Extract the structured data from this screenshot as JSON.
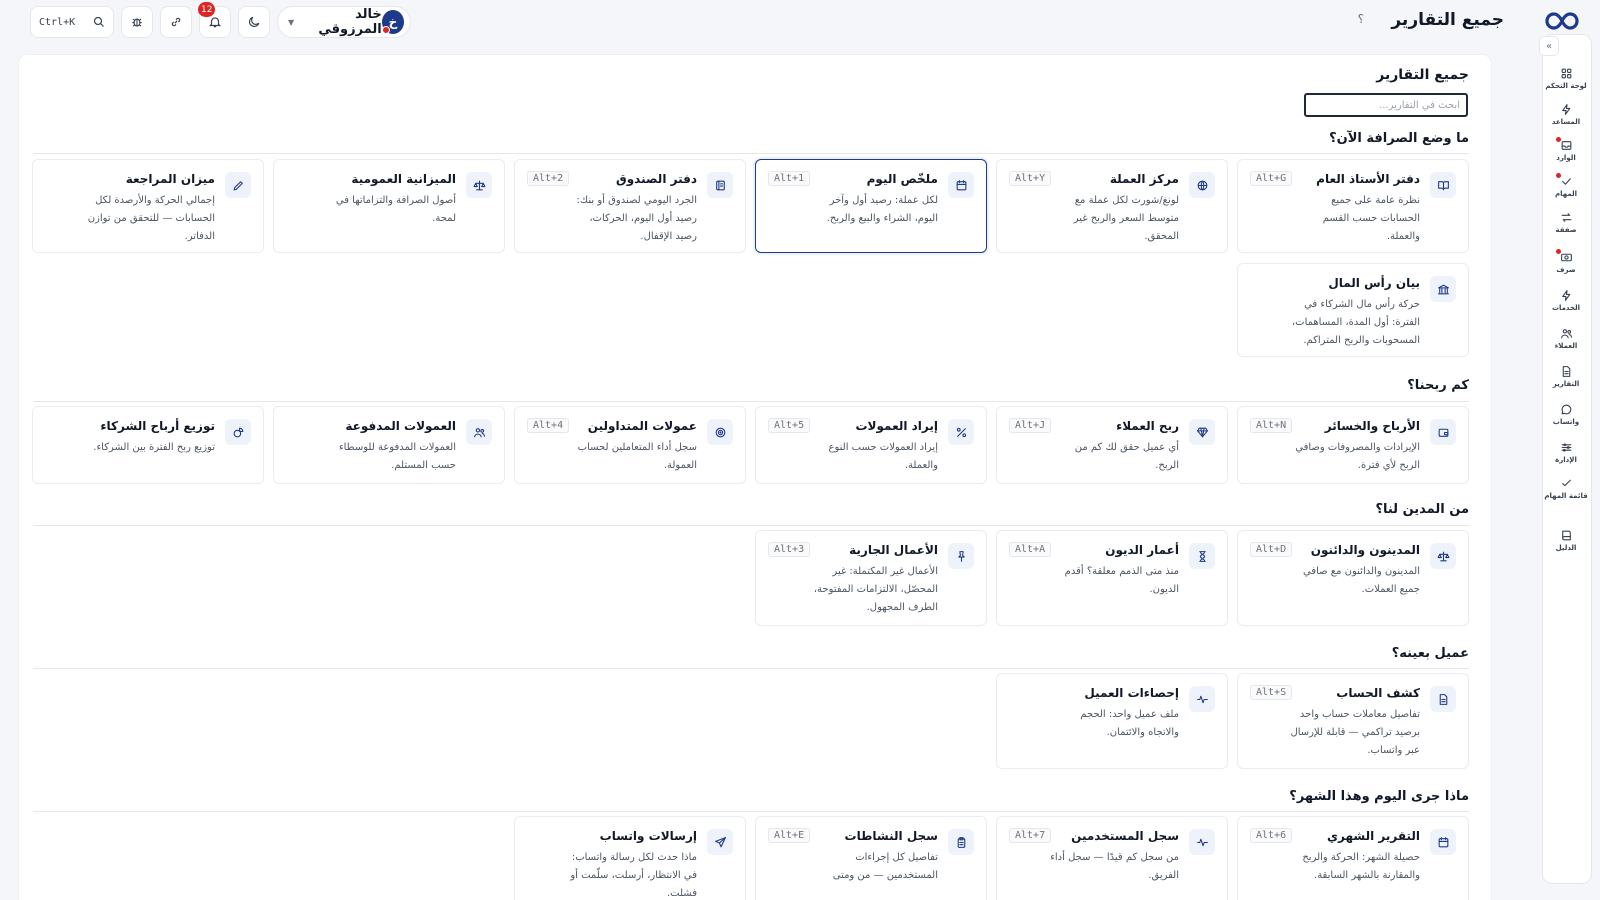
{
  "header": {
    "title": "جميع التقارير",
    "help": "؟",
    "search_shortcut": "Ctrl+K",
    "notifications_count": "12",
    "user": {
      "name": "خالد المرزوقي",
      "initial": "خ"
    }
  },
  "sidebar": {
    "items": [
      {
        "label": "لوحة التحكم",
        "icon": "dashboard-icon"
      },
      {
        "label": "المساعد",
        "icon": "bolt-icon"
      },
      {
        "label": "الوارد",
        "icon": "inbox-icon",
        "dot": true
      },
      {
        "label": "المهام",
        "icon": "check-icon",
        "dot": true
      },
      {
        "label": "صفقة",
        "icon": "exchange-icon"
      },
      {
        "label": "صرف",
        "icon": "cash-icon",
        "dot": true
      },
      {
        "label": "الخدمات",
        "icon": "bolt-icon"
      },
      {
        "label": "العملاء",
        "icon": "users-icon"
      },
      {
        "label": "التقارير",
        "icon": "document-icon"
      },
      {
        "label": "واتساب",
        "icon": "chat-icon"
      },
      {
        "label": "الإدارة",
        "icon": "sliders-icon"
      },
      {
        "label": "قائمة المهام",
        "icon": "checklist-icon"
      },
      {
        "label": "الدليل",
        "icon": "book-icon"
      }
    ]
  },
  "main": {
    "title": "جميع التقارير",
    "search_placeholder": "ابحث في التقارير...",
    "sections": [
      {
        "title": "ما وضع الصرافة الآن؟",
        "cards": [
          {
            "title": "دفتر الأستاذ العام",
            "desc": "نظرة عامة على جميع الحسابات حسب القسم والعملة.",
            "kbd": "Alt+G",
            "icon": "book-open-icon"
          },
          {
            "title": "مركز العملة",
            "desc": "لونغ/شورت لكل عملة مع متوسط السعر والربح غير المحقق.",
            "kbd": "Alt+Y",
            "icon": "globe-icon"
          },
          {
            "title": "ملخّص اليوم",
            "desc": "لكل عملة: رصيد أول وآخر اليوم، الشراء والبيع والربح.",
            "kbd": "Alt+1",
            "icon": "calendar-icon",
            "active": true
          },
          {
            "title": "دفتر الصندوق",
            "desc": "الجرد اليومي لصندوق أو بنك: رصيد أول اليوم، الحركات، رصيد الإقفال.",
            "kbd": "Alt+2",
            "icon": "ledger-icon"
          },
          {
            "title": "الميزانية العمومية",
            "desc": "أصول الصرافة والتزاماتها في لمحة.",
            "kbd": "",
            "icon": "scale-icon"
          },
          {
            "title": "ميزان المراجعة",
            "desc": "إجمالي الحركة والأرصدة لكل الحسابات — للتحقق من توازن الدفاتر.",
            "kbd": "",
            "icon": "pen-icon"
          },
          {
            "title": "بيان رأس المال",
            "desc": "حركة رأس مال الشركاء في الفترة: أول المدة، المساهمات، المسحوبات والربح المتراكم.",
            "kbd": "",
            "icon": "bank-icon"
          }
        ]
      },
      {
        "title": "كم ربحنا؟",
        "cards": [
          {
            "title": "الأرباح والخسائر",
            "desc": "الإيرادات والمصروفات وصافي الربح لأي فترة.",
            "kbd": "Alt+N",
            "icon": "wallet-icon"
          },
          {
            "title": "ربح العملاء",
            "desc": "أي عميل حقق لك كم من الربح.",
            "kbd": "Alt+J",
            "icon": "diamond-icon"
          },
          {
            "title": "إيراد العمولات",
            "desc": "إيراد العمولات حسب النوع والعملة.",
            "kbd": "Alt+5",
            "icon": "percent-icon"
          },
          {
            "title": "عمولات المتداولين",
            "desc": "سجل أداء المتعاملين لحساب العمولة.",
            "kbd": "Alt+4",
            "icon": "target-icon"
          },
          {
            "title": "العمولات المدفوعة",
            "desc": "العمولات المدفوعة للوسطاء حسب المستلم.",
            "kbd": "",
            "icon": "users-icon"
          },
          {
            "title": "توزيع أرباح الشركاء",
            "desc": "توزيع ربح الفترة بين الشركاء.",
            "kbd": "",
            "icon": "pie-icon"
          }
        ]
      },
      {
        "title": "من المدين لنا؟",
        "cards": [
          {
            "title": "المدينون والدائنون",
            "desc": "المدينون والدائنون مع صافي جميع العملات.",
            "kbd": "Alt+D",
            "icon": "scale-icon"
          },
          {
            "title": "أعمار الديون",
            "desc": "منذ متى الذمم معلقة؟ أقدم الديون.",
            "kbd": "Alt+A",
            "icon": "hourglass-icon"
          },
          {
            "title": "الأعمال الجارية",
            "desc": "الأعمال غير المكتملة: غير المحصّل، الالتزامات المفتوحة، الطرف المجهول.",
            "kbd": "Alt+3",
            "icon": "pin-icon"
          }
        ]
      },
      {
        "title": "عميل بعينه؟",
        "cards": [
          {
            "title": "كشف الحساب",
            "desc": "تفاصيل معاملات حساب واحد برصيد تراكمي — قابلة للإرسال عبر واتساب.",
            "kbd": "Alt+S",
            "icon": "document-icon"
          },
          {
            "title": "إحصاءات العميل",
            "desc": "ملف عميل واحد: الحجم والاتجاه والائتمان.",
            "kbd": "",
            "icon": "pulse-icon"
          }
        ]
      },
      {
        "title": "ماذا جرى اليوم وهذا الشهر؟",
        "cards": [
          {
            "title": "التقرير الشهري",
            "desc": "حصيلة الشهر: الحركة والربح والمقارنة بالشهر السابقة.",
            "kbd": "Alt+6",
            "icon": "calendar-icon"
          },
          {
            "title": "سجل المستخدمين",
            "desc": "من سجل كم قيدًا — سجل أداء الفريق.",
            "kbd": "Alt+7",
            "icon": "pulse-icon"
          },
          {
            "title": "سجل النشاطات",
            "desc": "تفاصيل كل إجراءات المستخدمين — من ومتى",
            "kbd": "Alt+E",
            "icon": "clipboard-icon"
          },
          {
            "title": "إرسالات واتساب",
            "desc": "ماذا حدث لكل رسالة واتساب: في الانتظار، أرسلت، سلّمت أو فشلت.",
            "kbd": "",
            "icon": "send-icon"
          }
        ]
      }
    ]
  }
}
